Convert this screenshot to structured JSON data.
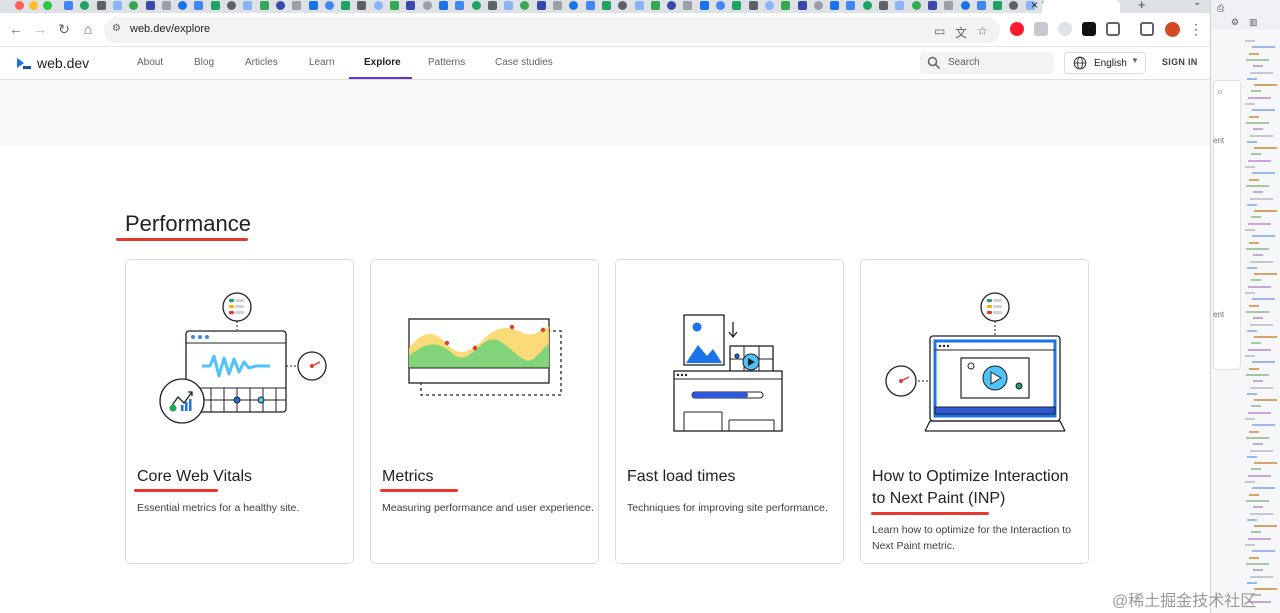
{
  "browser": {
    "url": "web.dev/explore"
  },
  "site": {
    "logo": "web.dev",
    "nav": [
      "About",
      "Blog",
      "Articles",
      "Learn",
      "Explore",
      "Patterns",
      "Case studies"
    ],
    "active_nav": "Explore",
    "search_placeholder": "Search",
    "language": "English",
    "sign_in": "SIGN IN"
  },
  "section": {
    "title": "Performance"
  },
  "cards": [
    {
      "title": "Core Web Vitals",
      "description": "Essential metrics for a healthy site."
    },
    {
      "title": "Metrics",
      "description": "Measuring performance and user experience."
    },
    {
      "title": "Fast load times",
      "description": "Techniques for improving site performance."
    },
    {
      "title": "How to Optimize Interaction to Next Paint (INP)",
      "description": "Learn how to optimize for the Interaction to Next Paint metric."
    }
  ],
  "devtools": {
    "labels": [
      "ent",
      "ent"
    ]
  },
  "watermark": "@稀土掘金技术社区",
  "colors": {
    "accent": "#6733d0",
    "annotation": "#e8372c",
    "brand_blue": "#1a73e8"
  }
}
